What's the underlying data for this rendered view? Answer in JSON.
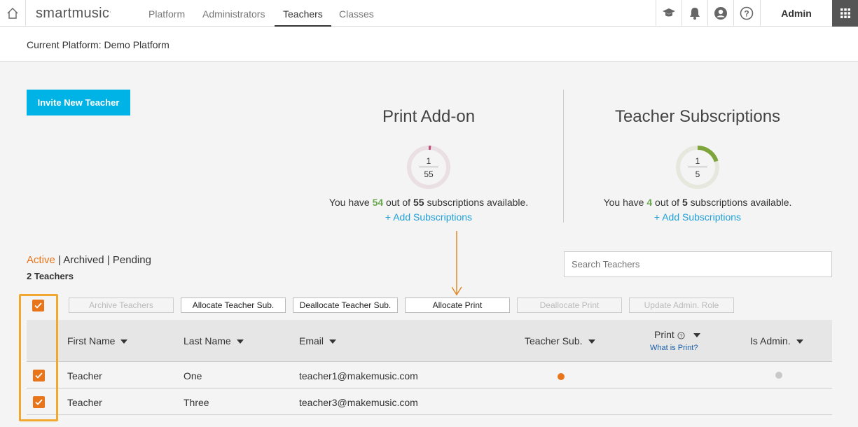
{
  "nav": {
    "logo": "smartmusic",
    "tabs": [
      "Platform",
      "Administrators",
      "Teachers",
      "Classes"
    ],
    "active_tab": "Teachers",
    "user": "Admin"
  },
  "platform_bar": "Current Platform: Demo Platform",
  "invite_label": "Invite New Teacher",
  "print_panel": {
    "title": "Print Add-on",
    "used": 1,
    "total": 55,
    "summary_prefix": "You have",
    "available": 54,
    "summary_mid": "out of",
    "summary_suffix": "subscriptions available.",
    "add_label": "+ Add Subscriptions",
    "color": "#c0507a"
  },
  "teacher_panel": {
    "title": "Teacher Subscriptions",
    "used": 1,
    "total": 5,
    "summary_prefix": "You have",
    "available": 4,
    "summary_mid": "out of",
    "summary_suffix": "subscriptions available.",
    "add_label": "+ Add Subscriptions",
    "color": "#7ea53b"
  },
  "filters": {
    "active": "Active",
    "archived": "Archived",
    "pending": "Pending",
    "sep": "|"
  },
  "count": "2 Teachers",
  "search_placeholder": "Search Teachers",
  "actions": {
    "archive": "Archive Teachers",
    "allocate_sub": "Allocate Teacher Sub.",
    "deallocate_sub": "Deallocate Teacher Sub.",
    "allocate_print": "Allocate Print",
    "deallocate_print": "Deallocate Print",
    "update_admin": "Update Admin. Role"
  },
  "table": {
    "headers": {
      "first": "First Name",
      "last": "Last Name",
      "email": "Email",
      "teacher_sub": "Teacher Sub.",
      "print": "Print",
      "print_help": "What is Print?",
      "is_admin": "Is Admin."
    },
    "rows": [
      {
        "first": "Teacher",
        "last": "One",
        "email": "teacher1@makemusic.com",
        "teacher_sub": true,
        "admin_dot": true
      },
      {
        "first": "Teacher",
        "last": "Three",
        "email": "teacher3@makemusic.com",
        "teacher_sub": false,
        "admin_dot": false
      }
    ]
  },
  "colors": {
    "accent": "#e8751a",
    "link": "#1ea1d8",
    "highlight": "#f0a830",
    "invite": "#00b3e6"
  }
}
